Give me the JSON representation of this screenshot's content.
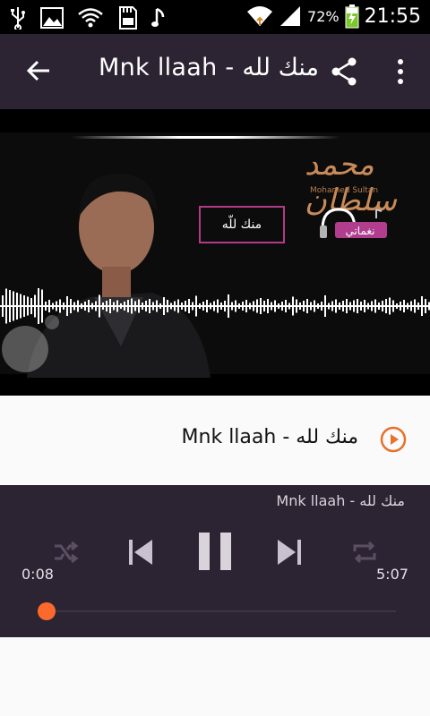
{
  "status_bar": {
    "battery_percent": "72%",
    "time": "21:55"
  },
  "app_bar": {
    "title": "Mnk llaah - منك لله"
  },
  "video": {
    "overlay_label": "منك للّه",
    "signature_sub": "Mohamed Sultan"
  },
  "track": {
    "title": "Mnk llaah - منك لله"
  },
  "player": {
    "title": "Mnk llaah - منك لله",
    "current_time": "0:08",
    "total_time": "5:07",
    "progress": 0.026
  },
  "colors": {
    "appbar": "#2d2433",
    "accent": "#fb6a2c",
    "play_icon": "#e8712b"
  }
}
